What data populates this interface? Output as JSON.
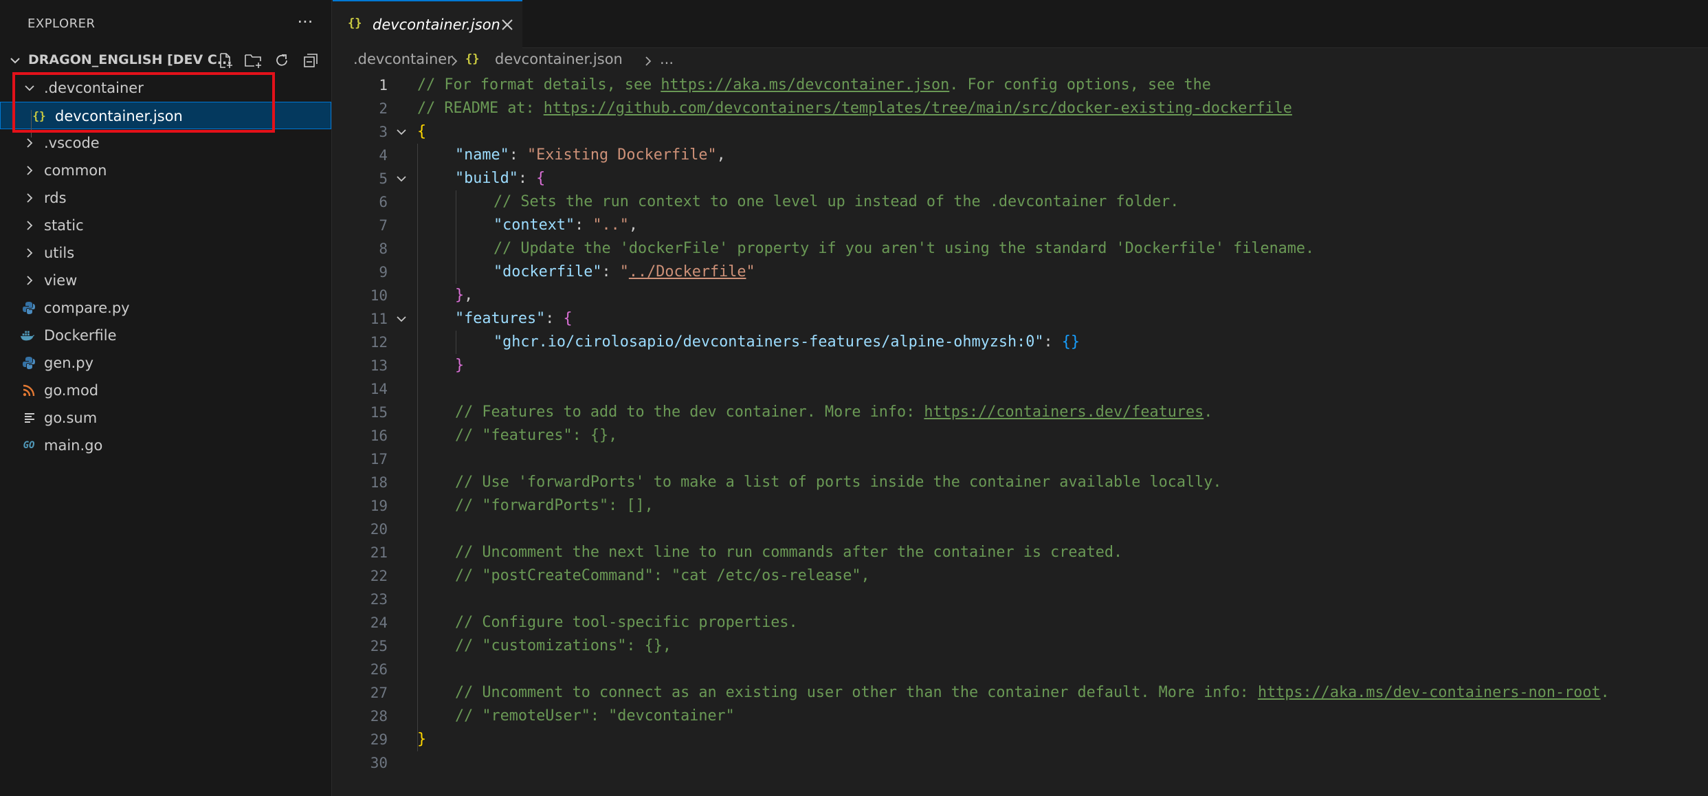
{
  "sidebar": {
    "header": "EXPLORER",
    "more_icon": "ellipsis-icon",
    "root": {
      "label": "DRAGON_ENGLISH [DEV C...",
      "actions": [
        "new-file-icon",
        "new-folder-icon",
        "refresh-icon",
        "collapse-all-icon"
      ]
    },
    "tree": [
      {
        "label": ".devcontainer",
        "type": "folder",
        "expanded": true
      },
      {
        "label": "devcontainer.json",
        "type": "json",
        "icon": "{}",
        "selected": true
      },
      {
        "label": ".vscode",
        "type": "folder"
      },
      {
        "label": "common",
        "type": "folder"
      },
      {
        "label": "rds",
        "type": "folder"
      },
      {
        "label": "static",
        "type": "folder"
      },
      {
        "label": "utils",
        "type": "folder"
      },
      {
        "label": "view",
        "type": "folder"
      },
      {
        "label": "compare.py",
        "type": "python"
      },
      {
        "label": "Dockerfile",
        "type": "docker"
      },
      {
        "label": "gen.py",
        "type": "python"
      },
      {
        "label": "go.mod",
        "type": "gomod"
      },
      {
        "label": "go.sum",
        "type": "gosum"
      },
      {
        "label": "main.go",
        "type": "go",
        "icon": "GO"
      }
    ]
  },
  "editor": {
    "tab": {
      "icon": "{}",
      "label": "devcontainer.json"
    },
    "breadcrumb": {
      "folder": ".devcontainer",
      "icon": "{}",
      "file": "devcontainer.json",
      "tail": "..."
    },
    "line_numbers": [
      "1",
      "2",
      "3",
      "4",
      "5",
      "6",
      "7",
      "8",
      "9",
      "10",
      "11",
      "12",
      "13",
      "14",
      "15",
      "16",
      "17",
      "18",
      "19",
      "20",
      "21",
      "22",
      "23",
      "24",
      "25",
      "26",
      "27",
      "28",
      "29",
      "30"
    ],
    "code": {
      "l1_a": "// For format details, see ",
      "l1_url": "https://aka.ms/devcontainer.json",
      "l1_b": ". For config options, see the",
      "l2_a": "// README at: ",
      "l2_url": "https://github.com/devcontainers/templates/tree/main/src/docker-existing-dockerfile",
      "l3": "{",
      "l4_key": "\"name\"",
      "l4_colon": ": ",
      "l4_val": "\"Existing Dockerfile\"",
      "l4_comma": ",",
      "l5_key": "\"build\"",
      "l5_colon": ": ",
      "l5_brace": "{",
      "l6": "// Sets the run context to one level up instead of the .devcontainer folder.",
      "l7_key": "\"context\"",
      "l7_colon": ": ",
      "l7_val": "\"..\"",
      "l7_comma": ",",
      "l8": "// Update the 'dockerFile' property if you aren't using the standard 'Dockerfile' filename.",
      "l9_key": "\"dockerfile\"",
      "l9_colon": ": ",
      "l9_q1": "\"",
      "l9_val": "../Dockerfile",
      "l9_q2": "\"",
      "l10_brace": "}",
      "l10_comma": ",",
      "l11_key": "\"features\"",
      "l11_colon": ": ",
      "l11_brace": "{",
      "l12_key": "\"ghcr.io/cirolosapio/devcontainers-features/alpine-ohmyzsh:0\"",
      "l12_colon": ": ",
      "l12_val": "{}",
      "l13_brace": "}",
      "l15_a": "// Features to add to the dev container. More info: ",
      "l15_url": "https://containers.dev/features",
      "l15_b": ".",
      "l16": "// \"features\": {},",
      "l18": "// Use 'forwardPorts' to make a list of ports inside the container available locally.",
      "l19": "// \"forwardPorts\": [],",
      "l21": "// Uncomment the next line to run commands after the container is created.",
      "l22": "// \"postCreateCommand\": \"cat /etc/os-release\",",
      "l24": "// Configure tool-specific properties.",
      "l25": "// \"customizations\": {},",
      "l27_a": "// Uncomment to connect as an existing user other than the container default. More info: ",
      "l27_url": "https://aka.ms/dev-containers-non-root",
      "l27_b": ".",
      "l28": "// \"remoteUser\": \"devcontainer\"",
      "l29": "}"
    }
  },
  "colors": {
    "accent": "#0078d4",
    "highlight_box": "#e3111a",
    "comment": "#6a9955",
    "key": "#9cdcfe",
    "string": "#ce9178",
    "json_icon": "#cbcb41"
  }
}
